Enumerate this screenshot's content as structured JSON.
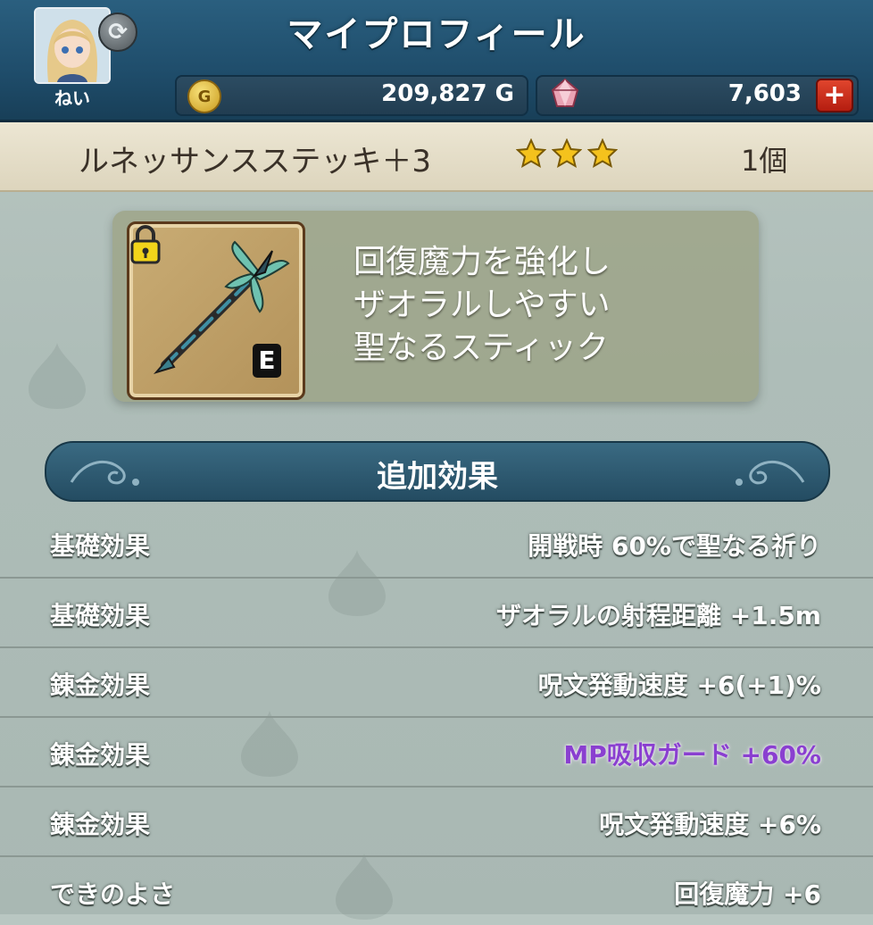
{
  "header": {
    "title": "マイプロフィール",
    "user_name": "ねい",
    "gold_icon_letter": "G",
    "gold": "209,827 G",
    "gems": "7,603",
    "add_button_label": "+"
  },
  "item": {
    "name": "ルネッサンスステッキ＋3",
    "rarity_stars": 3,
    "count": "1個",
    "equip_badge": "E",
    "description": [
      "回復魔力を強化し",
      "ザオラルしやすい",
      "聖なるスティック"
    ]
  },
  "section": {
    "title": "追加効果"
  },
  "effects": [
    {
      "label": "基礎効果",
      "value": "開戦時 60%で聖なる祈り",
      "special": false
    },
    {
      "label": "基礎効果",
      "value": "ザオラルの射程距離 +1.5m",
      "special": false
    },
    {
      "label": "錬金効果",
      "value": "呪文発動速度 +6(+1)%",
      "special": false
    },
    {
      "label": "錬金効果",
      "value": "MP吸収ガード +60%",
      "special": true
    },
    {
      "label": "錬金効果",
      "value": "呪文発動速度 +6%",
      "special": false
    },
    {
      "label": "できのよさ",
      "value": "回復魔力 +6",
      "special": false
    }
  ],
  "colors": {
    "header_bg": "#1f4d6b",
    "special_effect": "#8a3fd0",
    "star": "#f4c21d"
  }
}
